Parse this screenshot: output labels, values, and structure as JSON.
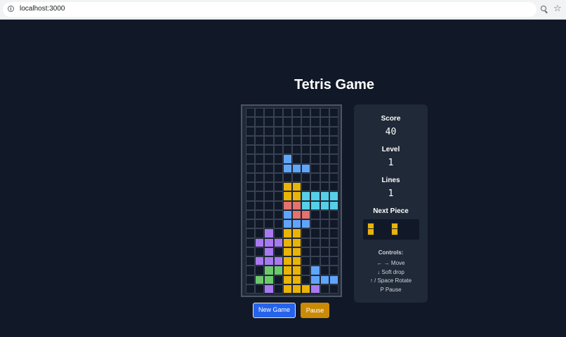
{
  "browser": {
    "url": "localhost:3000",
    "icons": [
      "info-icon",
      "zoom-icon",
      "star-icon"
    ]
  },
  "title": "Tetris Game",
  "stats": {
    "score_label": "Score",
    "score": "40",
    "level_label": "Level",
    "level": "1",
    "lines_label": "Lines",
    "lines": "1",
    "next_label": "Next Piece"
  },
  "next_piece": {
    "color": "#eab308",
    "cells": [
      [
        0,
        0
      ],
      [
        0,
        1
      ],
      [
        1,
        0
      ],
      [
        1,
        1
      ]
    ]
  },
  "controls": {
    "title": "Controls:",
    "lines": [
      "← → Move",
      "↓ Soft drop",
      "↑ / Space Rotate",
      "P Pause"
    ]
  },
  "buttons": {
    "new_game": "New Game",
    "pause": "Pause"
  },
  "colors": {
    "Y": "#eab308",
    "B": "#60a5fa",
    "C": "#56cfe8",
    "R": "#e5726d",
    "P": "#a879f0",
    "G": "#6bc96b"
  },
  "board": {
    "cols": 10,
    "rows": 20,
    "cells": [
      "..........",
      "..........",
      "..........",
      "..........",
      "..........",
      "....B.....",
      "....BBB...",
      "..........",
      "....YY....",
      "....YYCCCC",
      "....RRCCCC",
      "....BRR...",
      "....BBB...",
      "..P.YY....",
      ".PPPYY....",
      "..P.YY....",
      ".PPPYY....",
      "..GGYY.B..",
      ".GG.YY.BBB",
      "..P.YYYP.."
    ]
  }
}
